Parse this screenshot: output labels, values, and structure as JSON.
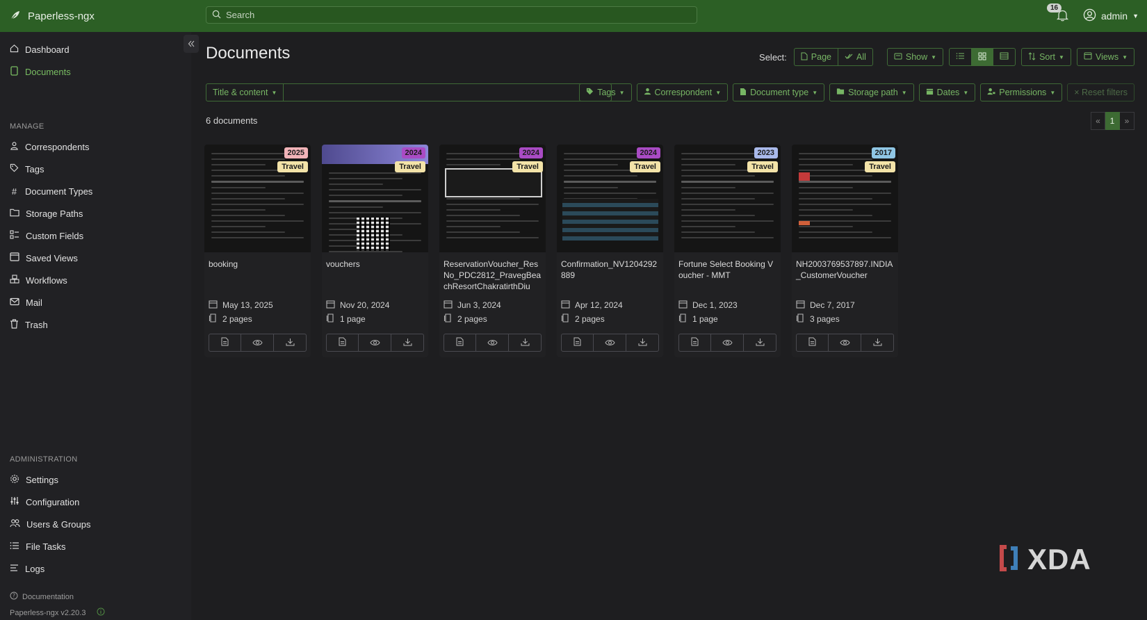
{
  "app": {
    "name": "Paperless-ngx"
  },
  "search": {
    "placeholder": "Search"
  },
  "notifications": {
    "count": "16"
  },
  "user": {
    "name": "admin"
  },
  "sidebar": {
    "top_items": [
      {
        "label": "Dashboard",
        "icon": "house-icon"
      },
      {
        "label": "Documents",
        "icon": "file-icon",
        "active": true
      }
    ],
    "manage_heading": "MANAGE",
    "manage_items": [
      {
        "label": "Correspondents",
        "icon": "person-icon"
      },
      {
        "label": "Tags",
        "icon": "tag-icon"
      },
      {
        "label": "Document Types",
        "icon": "hash-icon"
      },
      {
        "label": "Storage Paths",
        "icon": "folder-icon"
      },
      {
        "label": "Custom Fields",
        "icon": "ui-checks-icon"
      },
      {
        "label": "Saved Views",
        "icon": "window-stack-icon"
      },
      {
        "label": "Workflows",
        "icon": "boxes-icon"
      },
      {
        "label": "Mail",
        "icon": "envelope-icon"
      },
      {
        "label": "Trash",
        "icon": "trash-icon"
      }
    ],
    "admin_heading": "ADMINISTRATION",
    "admin_items": [
      {
        "label": "Settings",
        "icon": "gear-icon"
      },
      {
        "label": "Configuration",
        "icon": "sliders-icon"
      },
      {
        "label": "Users & Groups",
        "icon": "people-icon"
      },
      {
        "label": "File Tasks",
        "icon": "list-task-icon"
      },
      {
        "label": "Logs",
        "icon": "text-lines-icon"
      }
    ],
    "documentation": "Documentation",
    "version": "Paperless-ngx v2.20.3"
  },
  "main": {
    "title": "Documents",
    "select_label": "Select:",
    "select_page": "Page",
    "select_all": "All",
    "show": "Show",
    "sort": "Sort",
    "views": "Views",
    "title_content": "Title & content",
    "filters": {
      "tags": "Tags",
      "correspondent": "Correspondent",
      "document_type": "Document type",
      "storage_path": "Storage path",
      "dates": "Dates",
      "permissions": "Permissions",
      "reset": "× Reset filters"
    },
    "doc_count": "6 documents",
    "pagination": {
      "prev": "«",
      "current": "1",
      "next": "»"
    }
  },
  "documents": [
    {
      "title": "booking",
      "year": "2025",
      "year_color": "#f1b3b8",
      "tag": "Travel",
      "date": "May 13, 2025",
      "pages": "2 pages"
    },
    {
      "title": "vouchers",
      "year": "2024",
      "year_color": "#a94bc4",
      "tag": "Travel",
      "date": "Nov 20, 2024",
      "pages": "1 page"
    },
    {
      "title": "ReservationVoucher_ResNo_PDC2812_PravegBeachResortChakratirthDiu",
      "year": "2024",
      "year_color": "#a94bc4",
      "tag": "Travel",
      "date": "Jun 3, 2024",
      "pages": "2 pages"
    },
    {
      "title": "Confirmation_NV1204292889",
      "year": "2024",
      "year_color": "#a94bc4",
      "tag": "Travel",
      "date": "Apr 12, 2024",
      "pages": "2 pages"
    },
    {
      "title": "Fortune Select Booking Voucher - MMT",
      "year": "2023",
      "year_color": "#a9b9ea",
      "tag": "Travel",
      "date": "Dec 1, 2023",
      "pages": "1 page"
    },
    {
      "title": "NH2003769537897.INDIA_CustomerVoucher",
      "year": "2017",
      "year_color": "#8fc6e4",
      "tag": "Travel",
      "date": "Dec 7, 2017",
      "pages": "3 pages"
    }
  ],
  "watermark": {
    "text": "XDA"
  },
  "colors": {
    "accent": "#77b564",
    "topbar": "#2c5f25",
    "background": "#1e1e20",
    "sidebar": "#212124",
    "tag": "#f3e3a8"
  }
}
